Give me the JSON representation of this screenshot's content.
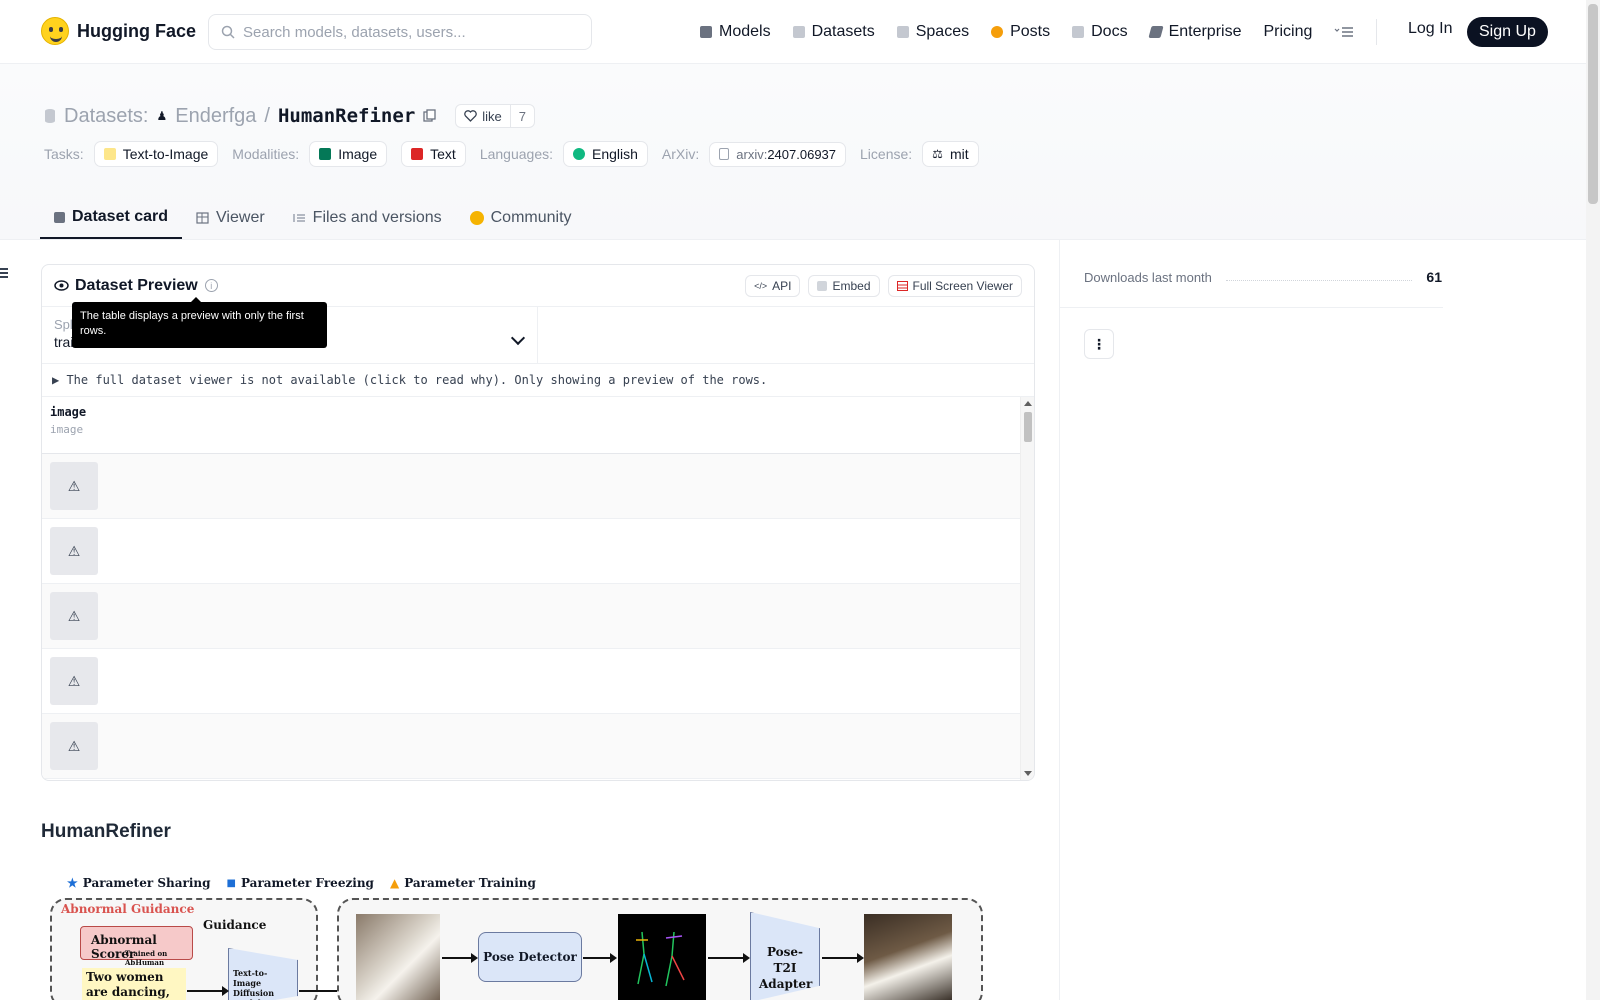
{
  "nav": {
    "brand": "Hugging Face",
    "search_placeholder": "Search models, datasets, users...",
    "items": [
      {
        "label": "Models",
        "icon": "cube-icon",
        "color": "#6b7280"
      },
      {
        "label": "Datasets",
        "icon": "database-icon",
        "color": "#9ca3af"
      },
      {
        "label": "Spaces",
        "icon": "spaces-icon",
        "color": "#9ca3af"
      },
      {
        "label": "Posts",
        "icon": "posts-icon",
        "color": "#f59e0b"
      },
      {
        "label": "Docs",
        "icon": "docs-icon",
        "color": "#9ca3af"
      },
      {
        "label": "Enterprise",
        "icon": "enterprise-icon",
        "color": "#6b7280"
      },
      {
        "label": "Pricing"
      }
    ],
    "login": "Log In",
    "signup": "Sign Up"
  },
  "header": {
    "section": "Datasets:",
    "owner": "Enderfga",
    "slash": "/",
    "name": "HumanRefiner",
    "like_label": "like",
    "like_count": "7",
    "tags": {
      "tasks_label": "Tasks:",
      "task": "Text-to-Image",
      "modalities_label": "Modalities:",
      "modality_image": "Image",
      "modality_text": "Text",
      "languages_label": "Languages:",
      "language": "English",
      "arxiv_label": "ArXiv:",
      "arxiv_prefix": "arxiv:",
      "arxiv_id": "2407.06937",
      "license_label": "License:",
      "license": "mit"
    }
  },
  "tabs": [
    {
      "label": "Dataset card",
      "active": true
    },
    {
      "label": "Viewer"
    },
    {
      "label": "Files and versions"
    },
    {
      "label": "Community"
    }
  ],
  "preview": {
    "title": "Dataset Preview",
    "api": "API",
    "embed": "Embed",
    "fullscreen": "Full Screen Viewer",
    "split_label": "Split",
    "split_value": "train",
    "tooltip": "The table displays a preview with only the first rows.",
    "notice": "▶ The full dataset viewer is not available (click to read why). Only showing a preview of the rows.",
    "column_name": "image",
    "column_type": "image",
    "rows": [
      "⚠",
      "⚠",
      "⚠",
      "⚠",
      "⚠"
    ]
  },
  "card_section_title": "HumanRefiner",
  "figure": {
    "legend": [
      "Parameter Sharing",
      "Parameter Freezing",
      "Parameter Training"
    ],
    "abnormal_guidance": "Abnormal Guidance",
    "guidance": "Guidance",
    "abnormal_scorer": "Abnormal Scorer",
    "trained_on": "Trained on AbHuman",
    "prompt": "Two women are dancing, ballet",
    "t2i": "Text-to-Image Diffusion Model",
    "pose_detector": "Pose Detector",
    "adapter": "Pose-T2I Adapter"
  },
  "sidebar": {
    "downloads_label": "Downloads last month",
    "downloads_value": "61"
  }
}
